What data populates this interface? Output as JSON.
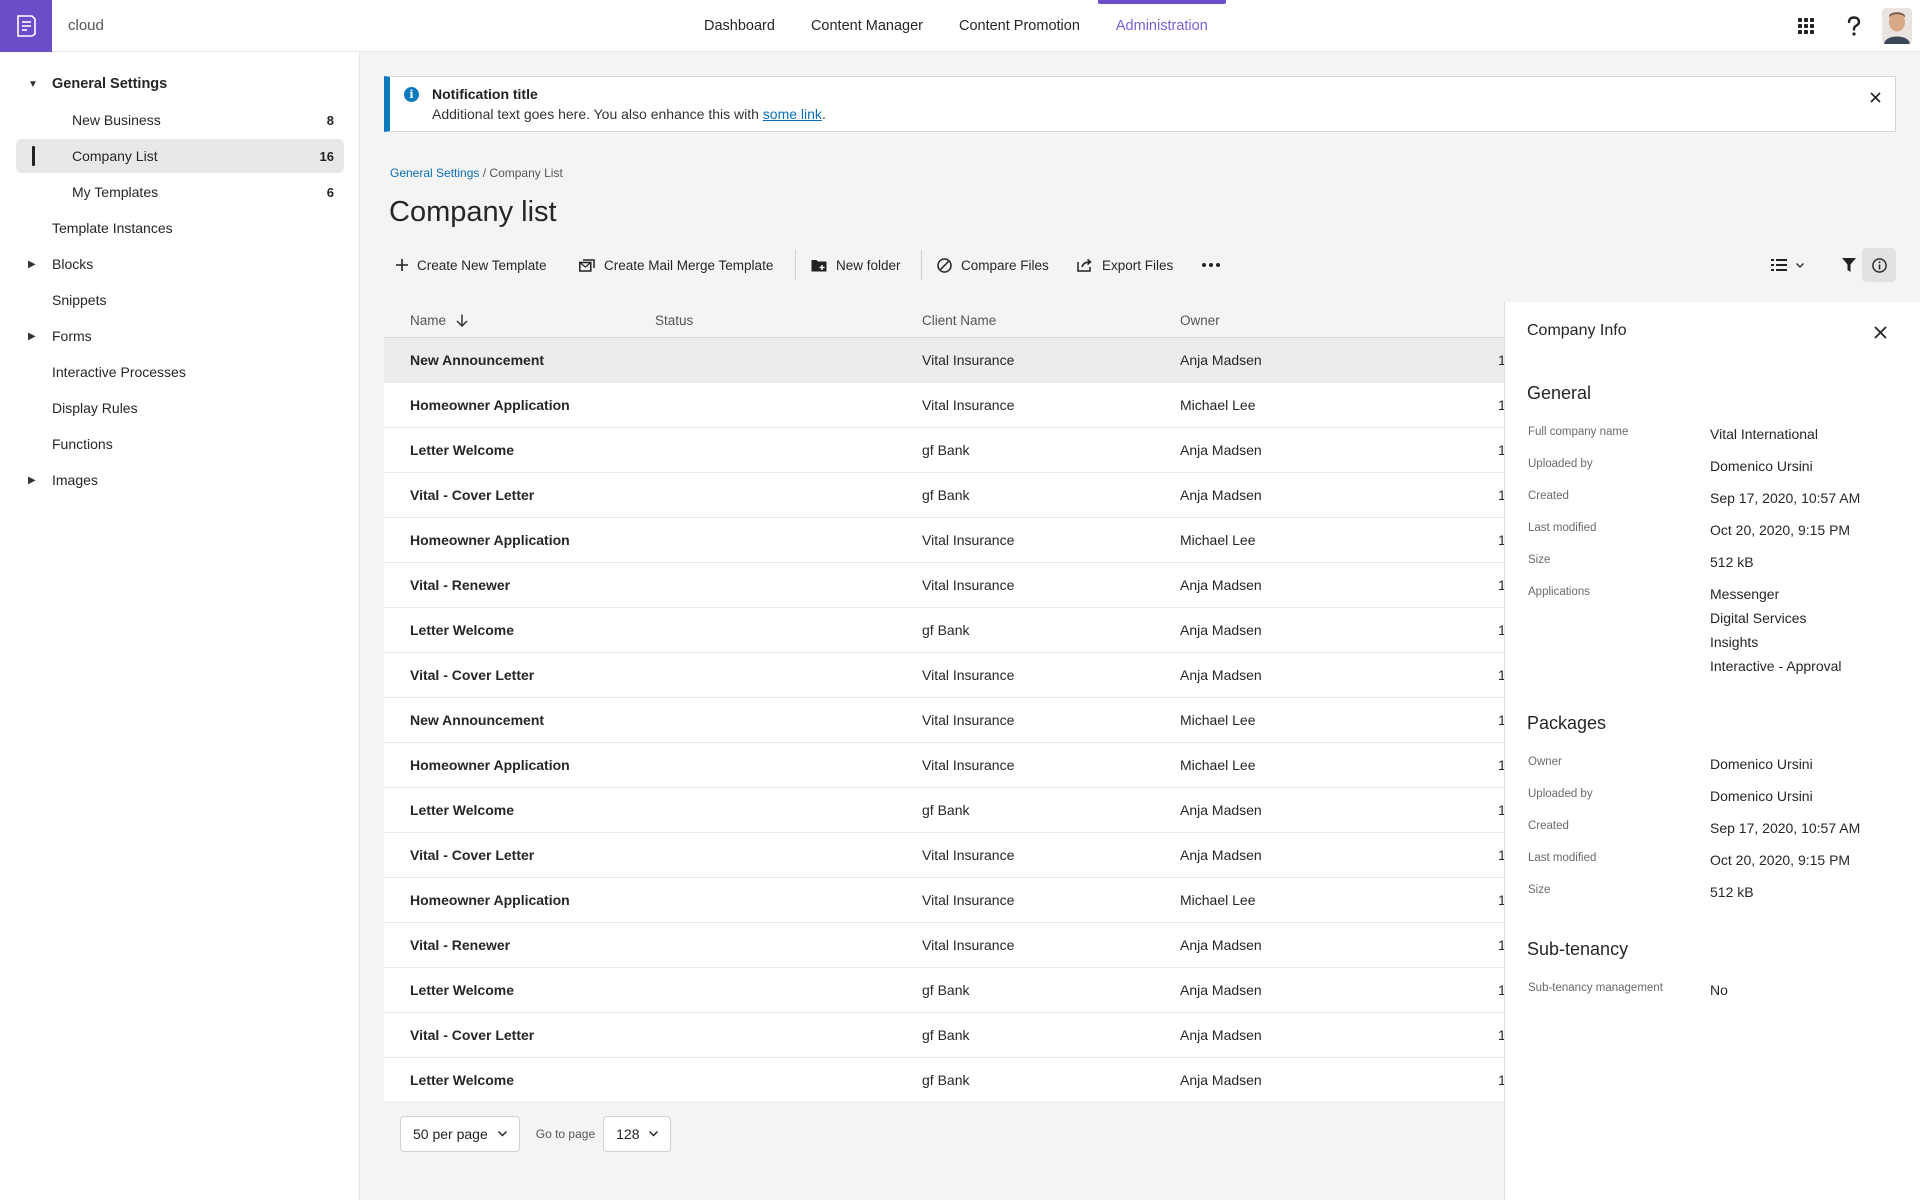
{
  "header": {
    "app_name": "cloud",
    "nav": [
      {
        "label": "Dashboard",
        "active": false
      },
      {
        "label": "Content Manager",
        "active": false
      },
      {
        "label": "Content Promotion",
        "active": false
      },
      {
        "label": "Administration",
        "active": true
      }
    ],
    "icons": [
      "apps-grid-icon",
      "help-icon",
      "user-avatar"
    ]
  },
  "sidebar": {
    "items": [
      {
        "label": "General Settings",
        "caret": "▼",
        "level": 0,
        "count": ""
      },
      {
        "label": "New Business",
        "caret": "",
        "level": 1,
        "count": "8"
      },
      {
        "label": "Company List",
        "caret": "",
        "level": 1,
        "count": "16",
        "selected": true
      },
      {
        "label": "My Templates",
        "caret": "",
        "level": 1,
        "count": "6"
      },
      {
        "label": "Template Instances",
        "caret": "",
        "level": 0,
        "count": ""
      },
      {
        "label": "Blocks",
        "caret": "▶",
        "level": 0,
        "count": ""
      },
      {
        "label": "Snippets",
        "caret": "",
        "level": 0,
        "count": ""
      },
      {
        "label": "Forms",
        "caret": "▶",
        "level": 0,
        "count": ""
      },
      {
        "label": "Interactive Processes",
        "caret": "",
        "level": 0,
        "count": ""
      },
      {
        "label": "Display Rules",
        "caret": "",
        "level": 0,
        "count": ""
      },
      {
        "label": "Functions",
        "caret": "",
        "level": 0,
        "count": ""
      },
      {
        "label": "Images",
        "caret": "▶",
        "level": 0,
        "count": ""
      }
    ]
  },
  "notification": {
    "title": "Notification title",
    "text": "Additional text goes here. You also enhance this with ",
    "link": "some link",
    "suffix": "."
  },
  "breadcrumb": {
    "parent": "General Settings",
    "separator": "/",
    "current": "Company List"
  },
  "page_title": "Company list",
  "toolbar": {
    "create_template": "Create New Template",
    "create_mail_merge": "Create Mail Merge Template",
    "new_folder": "New folder",
    "compare_files": "Compare Files",
    "export_files": "Export Files"
  },
  "table": {
    "columns": {
      "name": "Name",
      "status": "Status",
      "client": "Client Name",
      "owner": "Owner"
    },
    "rows": [
      {
        "name": "New Announcement",
        "client": "Vital Insurance",
        "owner": "Anja Madsen",
        "extra": "1"
      },
      {
        "name": "Homeowner Application",
        "client": "Vital Insurance",
        "owner": "Michael Lee",
        "extra": "1"
      },
      {
        "name": "Letter Welcome",
        "client": "gf Bank",
        "owner": "Anja Madsen",
        "extra": "1"
      },
      {
        "name": "Vital - Cover Letter",
        "client": "gf Bank",
        "owner": "Anja Madsen",
        "extra": "1"
      },
      {
        "name": "Homeowner Application",
        "client": "Vital Insurance",
        "owner": "Michael Lee",
        "extra": "1"
      },
      {
        "name": "Vital - Renewer",
        "client": "Vital Insurance",
        "owner": "Anja Madsen",
        "extra": "1"
      },
      {
        "name": "Letter Welcome",
        "client": "gf Bank",
        "owner": "Anja Madsen",
        "extra": "1"
      },
      {
        "name": "Vital - Cover Letter",
        "client": "Vital Insurance",
        "owner": "Anja Madsen",
        "extra": "1"
      },
      {
        "name": "New Announcement",
        "client": "Vital Insurance",
        "owner": "Michael Lee",
        "extra": "1"
      },
      {
        "name": "Homeowner Application",
        "client": "Vital Insurance",
        "owner": "Michael Lee",
        "extra": "1"
      },
      {
        "name": "Letter Welcome",
        "client": "gf Bank",
        "owner": "Anja Madsen",
        "extra": "1"
      },
      {
        "name": "Vital - Cover Letter",
        "client": "Vital Insurance",
        "owner": "Anja Madsen",
        "extra": "1"
      },
      {
        "name": "Homeowner Application",
        "client": "Vital Insurance",
        "owner": "Michael Lee",
        "extra": "1"
      },
      {
        "name": "Vital - Renewer",
        "client": "Vital Insurance",
        "owner": "Anja Madsen",
        "extra": "1"
      },
      {
        "name": "Letter Welcome",
        "client": "gf Bank",
        "owner": "Anja Madsen",
        "extra": "1"
      },
      {
        "name": "Vital - Cover Letter",
        "client": "gf Bank",
        "owner": "Anja Madsen",
        "extra": "1"
      },
      {
        "name": "Letter Welcome",
        "client": "gf Bank",
        "owner": "Anja Madsen",
        "extra": "1"
      }
    ]
  },
  "pagination": {
    "per_page": "50 per page",
    "goto_label": "Go to page",
    "page": "128"
  },
  "info_panel": {
    "title": "Company Info",
    "general": {
      "heading": "General",
      "fields": [
        {
          "key": "Full company name",
          "value": "Vital International"
        },
        {
          "key": "Uploaded by",
          "value": "Domenico Ursini"
        },
        {
          "key": "Created",
          "value": "Sep 17, 2020, 10:57 AM"
        },
        {
          "key": "Last modified",
          "value": "Oct 20, 2020, 9:15 PM"
        },
        {
          "key": "Size",
          "value": "512 kB"
        }
      ],
      "applications_key": "Applications",
      "applications": [
        "Messenger",
        "Digital Services",
        "Insights",
        "Interactive - Approval"
      ]
    },
    "packages": {
      "heading": "Packages",
      "fields": [
        {
          "key": "Owner",
          "value": "Domenico Ursini"
        },
        {
          "key": "Uploaded by",
          "value": "Domenico Ursini"
        },
        {
          "key": "Created",
          "value": "Sep 17, 2020, 10:57 AM"
        },
        {
          "key": "Last modified",
          "value": "Oct 20, 2020, 9:15 PM"
        },
        {
          "key": "Size",
          "value": "512 kB"
        }
      ]
    },
    "subtenancy": {
      "heading": "Sub-tenancy",
      "fields": [
        {
          "key": "Sub-tenancy management",
          "value": "No"
        }
      ]
    }
  },
  "colors": {
    "accent": "#6b4dc9",
    "active_nav": "#7b5fd6",
    "info": "#0b7bbd",
    "link": "#0b6fb8"
  }
}
